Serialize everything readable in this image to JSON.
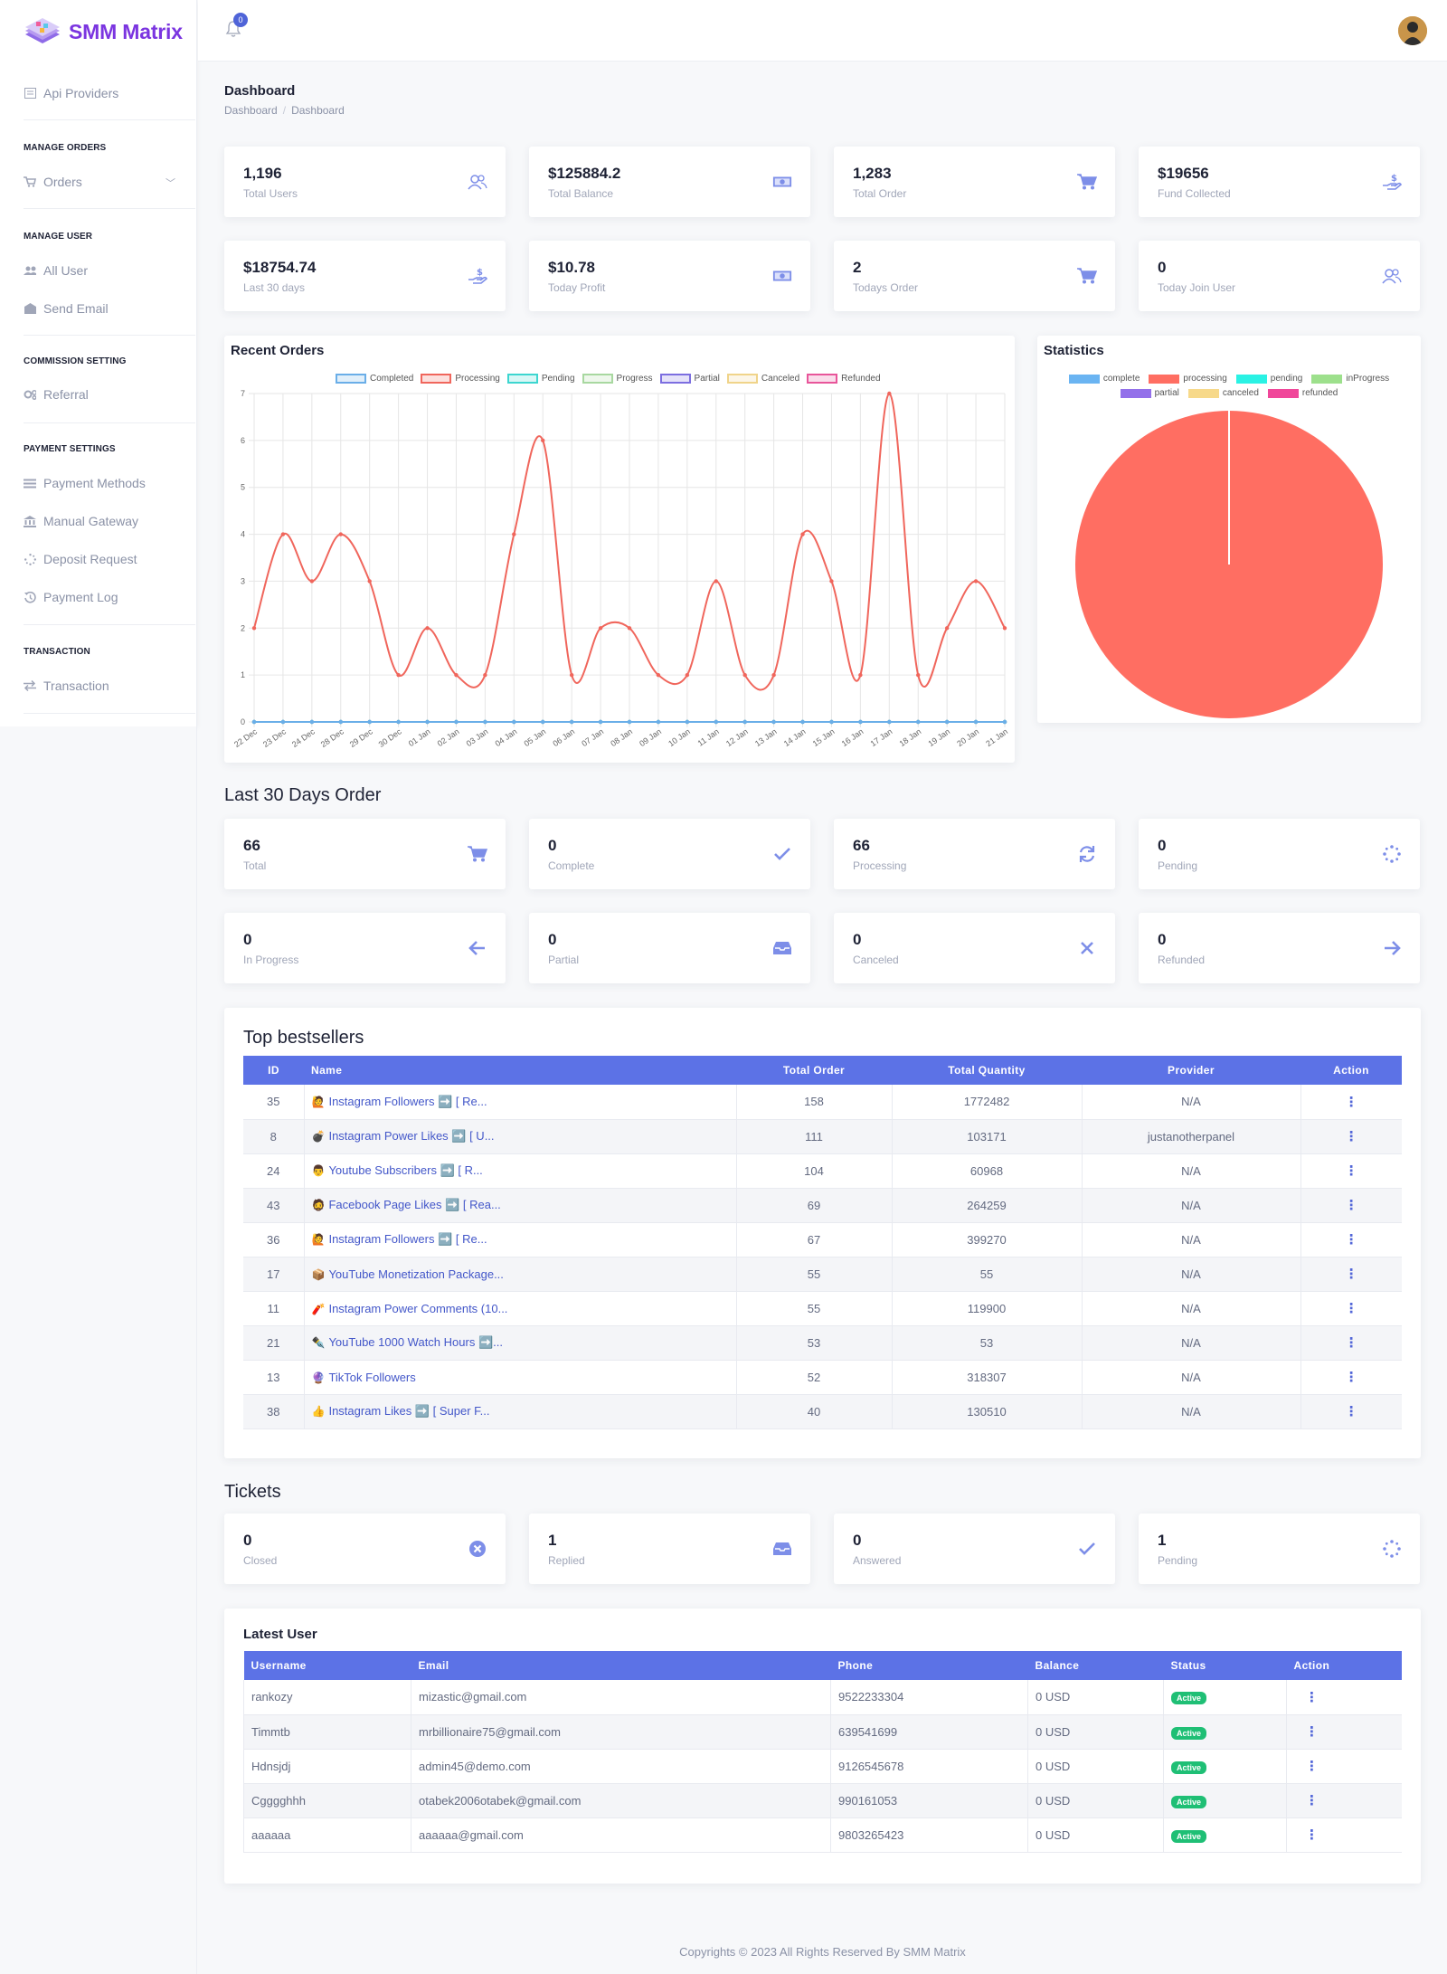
{
  "brand": {
    "name_a": "SMM",
    "name_b": "Matrix"
  },
  "sidebar": {
    "api_providers": "Api Providers",
    "h_orders": "MANAGE ORDERS",
    "orders": "Orders",
    "h_user": "MANAGE USER",
    "all_user": "All User",
    "send_email": "Send Email",
    "h_commission": "COMMISSION SETTING",
    "referral": "Referral",
    "h_payment": "PAYMENT SETTINGS",
    "payment_methods": "Payment Methods",
    "manual_gateway": "Manual Gateway",
    "deposit_request": "Deposit Request",
    "payment_log": "Payment Log",
    "h_transaction": "TRANSACTION",
    "transaction": "Transaction"
  },
  "topbar": {
    "notif_count": "0"
  },
  "page": {
    "title": "Dashboard",
    "bc1": "Dashboard",
    "bc2": "Dashboard"
  },
  "stats": [
    {
      "value": "1,196",
      "label": "Total Users",
      "icon": "users-icon"
    },
    {
      "value": "$125884.2",
      "label": "Total Balance",
      "icon": "money-icon"
    },
    {
      "value": "1,283",
      "label": "Total Order",
      "icon": "cart-icon"
    },
    {
      "value": "$19656",
      "label": "Fund Collected",
      "icon": "hand-dollar-icon"
    },
    {
      "value": "$18754.74",
      "label": "Last 30 days",
      "icon": "hand-dollar-icon"
    },
    {
      "value": "$10.78",
      "label": "Today Profit",
      "icon": "money-icon"
    },
    {
      "value": "2",
      "label": "Todays Order",
      "icon": "cart-icon"
    },
    {
      "value": "0",
      "label": "Today Join User",
      "icon": "users-icon"
    }
  ],
  "recent_orders": {
    "title": "Recent Orders"
  },
  "statistics": {
    "title": "Statistics"
  },
  "chart_data": [
    {
      "type": "line",
      "title": "Recent Orders",
      "x": [
        "22 Dec",
        "23 Dec",
        "24 Dec",
        "28 Dec",
        "29 Dec",
        "30 Dec",
        "01 Jan",
        "02 Jan",
        "03 Jan",
        "04 Jan",
        "05 Jan",
        "06 Jan",
        "07 Jan",
        "08 Jan",
        "09 Jan",
        "10 Jan",
        "11 Jan",
        "12 Jan",
        "13 Jan",
        "14 Jan",
        "15 Jan",
        "16 Jan",
        "17 Jan",
        "18 Jan",
        "19 Jan",
        "20 Jan",
        "21 Jan"
      ],
      "ylim": [
        0,
        7
      ],
      "yticks": [
        0,
        1,
        2,
        3,
        4,
        5,
        6,
        7
      ],
      "grid": true,
      "legend": "top",
      "series": [
        {
          "name": "Completed",
          "color": "#6aaee8",
          "values": [
            0,
            0,
            0,
            0,
            0,
            0,
            0,
            0,
            0,
            0,
            0,
            0,
            0,
            0,
            0,
            0,
            0,
            0,
            0,
            0,
            0,
            0,
            0,
            0,
            0,
            0,
            0
          ]
        },
        {
          "name": "Processing",
          "color": "#f0665c",
          "values": [
            2,
            4,
            3,
            4,
            3,
            1,
            2,
            1,
            1,
            4,
            6,
            1,
            2,
            2,
            1,
            1,
            3,
            1,
            1,
            4,
            3,
            1,
            7,
            1,
            2,
            3,
            2
          ]
        },
        {
          "name": "Pending",
          "color": "#3dd6d0",
          "values": [
            0,
            0,
            0,
            0,
            0,
            0,
            0,
            0,
            0,
            0,
            0,
            0,
            0,
            0,
            0,
            0,
            0,
            0,
            0,
            0,
            0,
            0,
            0,
            0,
            0,
            0,
            0
          ]
        },
        {
          "name": "Progress",
          "color": "#a8d8a0",
          "values": [
            0,
            0,
            0,
            0,
            0,
            0,
            0,
            0,
            0,
            0,
            0,
            0,
            0,
            0,
            0,
            0,
            0,
            0,
            0,
            0,
            0,
            0,
            0,
            0,
            0,
            0,
            0
          ]
        },
        {
          "name": "Partial",
          "color": "#7c6ee0",
          "values": [
            0,
            0,
            0,
            0,
            0,
            0,
            0,
            0,
            0,
            0,
            0,
            0,
            0,
            0,
            0,
            0,
            0,
            0,
            0,
            0,
            0,
            0,
            0,
            0,
            0,
            0,
            0
          ]
        },
        {
          "name": "Canceled",
          "color": "#f0d48a",
          "values": [
            0,
            0,
            0,
            0,
            0,
            0,
            0,
            0,
            0,
            0,
            0,
            0,
            0,
            0,
            0,
            0,
            0,
            0,
            0,
            0,
            0,
            0,
            0,
            0,
            0,
            0,
            0
          ]
        },
        {
          "name": "Refunded",
          "color": "#e8559a",
          "values": [
            0,
            0,
            0,
            0,
            0,
            0,
            0,
            0,
            0,
            0,
            0,
            0,
            0,
            0,
            0,
            0,
            0,
            0,
            0,
            0,
            0,
            0,
            0,
            0,
            0,
            0,
            0
          ]
        }
      ]
    },
    {
      "type": "pie",
      "title": "Statistics",
      "legend": "top",
      "labels": [
        "complete",
        "processing",
        "pending",
        "inProgress",
        "partial",
        "canceled",
        "refunded"
      ],
      "colors": [
        "#6ab4f2",
        "#ff6e62",
        "#2af2e4",
        "#9de08c",
        "#9370ea",
        "#f7d98a",
        "#f0479a"
      ],
      "values": [
        0,
        66,
        0,
        0,
        0,
        0,
        0
      ]
    }
  ],
  "last30": {
    "title": "Last 30 Days Order",
    "items": [
      {
        "value": "66",
        "label": "Total",
        "icon": "cart-icon"
      },
      {
        "value": "0",
        "label": "Complete",
        "icon": "check-icon"
      },
      {
        "value": "66",
        "label": "Processing",
        "icon": "refresh-icon"
      },
      {
        "value": "0",
        "label": "Pending",
        "icon": "spinner-icon"
      },
      {
        "value": "0",
        "label": "In Progress",
        "icon": "arrow-left-icon"
      },
      {
        "value": "0",
        "label": "Partial",
        "icon": "inbox-icon"
      },
      {
        "value": "0",
        "label": "Canceled",
        "icon": "x-icon"
      },
      {
        "value": "0",
        "label": "Refunded",
        "icon": "arrow-right-icon"
      }
    ]
  },
  "bestsellers": {
    "title": "Top bestsellers",
    "headers": [
      "ID",
      "Name",
      "Total Order",
      "Total Quantity",
      "Provider",
      "Action"
    ],
    "rows": [
      {
        "id": "35",
        "emoji": "🙋",
        "name": "Instagram Followers ➡️ [ Re...",
        "orders": "158",
        "qty": "1772482",
        "provider": "N/A"
      },
      {
        "id": "8",
        "emoji": "💣",
        "name": "Instagram Power Likes ➡️ [ U...",
        "orders": "111",
        "qty": "103171",
        "provider": "justanotherpanel"
      },
      {
        "id": "24",
        "emoji": "👨",
        "name": "Youtube Subscribers ➡️ [ R...",
        "orders": "104",
        "qty": "60968",
        "provider": "N/A"
      },
      {
        "id": "43",
        "emoji": "🧔",
        "name": "Facebook Page Likes ➡️ [ Rea...",
        "orders": "69",
        "qty": "264259",
        "provider": "N/A"
      },
      {
        "id": "36",
        "emoji": "🙋",
        "name": "Instagram Followers ➡️ [ Re...",
        "orders": "67",
        "qty": "399270",
        "provider": "N/A"
      },
      {
        "id": "17",
        "emoji": "📦",
        "name": "YouTube Monetization Package...",
        "orders": "55",
        "qty": "55",
        "provider": "N/A"
      },
      {
        "id": "11",
        "emoji": "🧨",
        "name": "Instagram Power Comments (10...",
        "orders": "55",
        "qty": "119900",
        "provider": "N/A"
      },
      {
        "id": "21",
        "emoji": "✒️",
        "name": "YouTube 1000 Watch Hours ➡️...",
        "orders": "53",
        "qty": "53",
        "provider": "N/A"
      },
      {
        "id": "13",
        "emoji": "🔮",
        "name": "TikTok Followers",
        "orders": "52",
        "qty": "318307",
        "provider": "N/A"
      },
      {
        "id": "38",
        "emoji": "👍",
        "name": "Instagram Likes ➡️ [ Super F...",
        "orders": "40",
        "qty": "130510",
        "provider": "N/A"
      }
    ]
  },
  "tickets": {
    "title": "Tickets",
    "items": [
      {
        "value": "0",
        "label": "Closed",
        "icon": "x-circle-icon"
      },
      {
        "value": "1",
        "label": "Replied",
        "icon": "inbox-icon"
      },
      {
        "value": "0",
        "label": "Answered",
        "icon": "check-icon"
      },
      {
        "value": "1",
        "label": "Pending",
        "icon": "spinner-icon"
      }
    ]
  },
  "latest_user": {
    "title": "Latest User",
    "headers": [
      "Username",
      "Email",
      "Phone",
      "Balance",
      "Status",
      "Action"
    ],
    "rows": [
      {
        "username": "rankozy",
        "email": "mizastic@gmail.com",
        "phone": "9522233304",
        "balance": "0 USD",
        "status": "Active"
      },
      {
        "username": "Timmtb",
        "email": "mrbillionaire75@gmail.com",
        "phone": "639541699",
        "balance": "0 USD",
        "status": "Active"
      },
      {
        "username": "Hdnsjdj",
        "email": "admin45@demo.com",
        "phone": "9126545678",
        "balance": "0 USD",
        "status": "Active"
      },
      {
        "username": "Cgggghhh",
        "email": "otabek2006otabek@gmail.com",
        "phone": "990161053",
        "balance": "0 USD",
        "status": "Active"
      },
      {
        "username": "aaaaaa",
        "email": "aaaaaa@gmail.com",
        "phone": "9803265423",
        "balance": "0 USD",
        "status": "Active"
      }
    ]
  },
  "footer": "Copyrights © 2023 All Rights Reserved By SMM Matrix"
}
